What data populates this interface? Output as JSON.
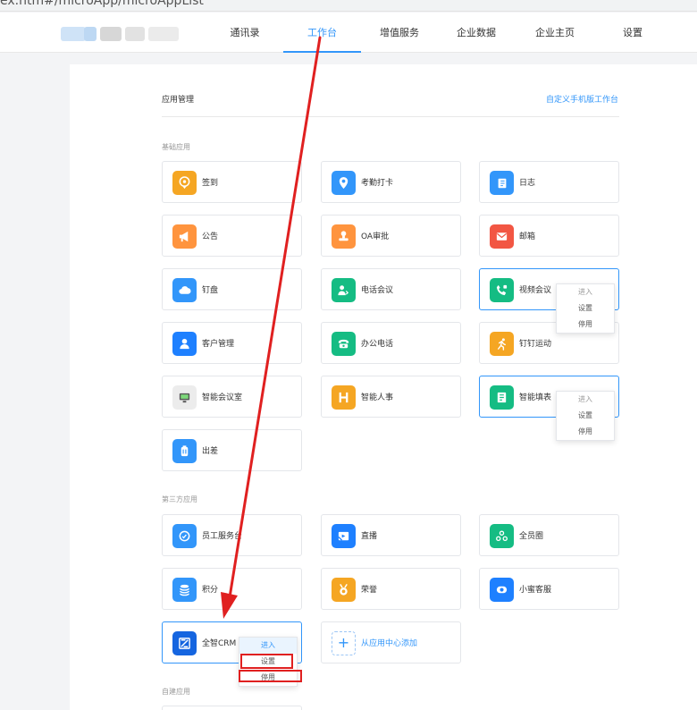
{
  "url": "ex.htm#/microApp/microAppList",
  "nav": {
    "items": [
      {
        "label": "通讯录",
        "active": false
      },
      {
        "label": "工作台",
        "active": true
      },
      {
        "label": "增值服务",
        "active": false
      },
      {
        "label": "企业数据",
        "active": false
      },
      {
        "label": "企业主页",
        "active": false
      },
      {
        "label": "设置",
        "active": false
      }
    ]
  },
  "main": {
    "title": "应用管理",
    "custom_link": "自定义手机版工作台",
    "sections": {
      "basic": "基础应用",
      "third": "第三方应用",
      "custom": "自建应用"
    },
    "apps": {
      "qiandao": {
        "name": "签到",
        "icon": "location-pin-icon",
        "color": "#f5a623"
      },
      "kaoqin": {
        "name": "考勤打卡",
        "icon": "location-pin-icon",
        "color": "#3296fa"
      },
      "rizhi": {
        "name": "日志",
        "icon": "notebook-icon",
        "color": "#3296fa"
      },
      "gonggao": {
        "name": "公告",
        "icon": "megaphone-icon",
        "color": "#ff943e"
      },
      "oa": {
        "name": "OA审批",
        "icon": "stamp-icon",
        "color": "#ff943e"
      },
      "youxiang": {
        "name": "邮箱",
        "icon": "mail-icon",
        "color": "#f25643"
      },
      "dingpan": {
        "name": "钉盘",
        "icon": "cloud-icon",
        "color": "#3296fa"
      },
      "dianhuahuiyi": {
        "name": "电话会议",
        "icon": "conference-call-icon",
        "color": "#15bc83"
      },
      "shipinhuiyi": {
        "name": "视频会议",
        "icon": "video-call-icon",
        "color": "#15bc83"
      },
      "kehu": {
        "name": "客户管理",
        "icon": "person-icon",
        "color": "#1e80ff"
      },
      "bangong": {
        "name": "办公电话",
        "icon": "telephone-icon",
        "color": "#15bc83"
      },
      "yundong": {
        "name": "钉钉运动",
        "icon": "running-icon",
        "color": "#f5a623"
      },
      "huiyishi": {
        "name": "智能会议室",
        "icon": "monitor-icon",
        "color": "#e8e8e8"
      },
      "renshi": {
        "name": "智能人事",
        "icon": "letter-h-icon",
        "color": "#f5a623"
      },
      "tianbiao": {
        "name": "智能填表",
        "icon": "form-icon",
        "color": "#15bc83"
      },
      "chuchai": {
        "name": "出差",
        "icon": "suitcase-icon",
        "color": "#3296fa"
      },
      "yuangong": {
        "name": "员工服务台",
        "icon": "chat-bot-icon",
        "color": "#3296fa"
      },
      "zhibo": {
        "name": "直播",
        "icon": "live-icon",
        "color": "#1e80ff"
      },
      "quanyuanquan": {
        "name": "全员圈",
        "icon": "circle-group-icon",
        "color": "#15bc83"
      },
      "jifen": {
        "name": "积分",
        "icon": "coins-icon",
        "color": "#3296fa"
      },
      "rongyu": {
        "name": "荣誉",
        "icon": "medal-icon",
        "color": "#f5a623"
      },
      "xiaomi": {
        "name": "小蜜客服",
        "icon": "headset-icon",
        "color": "#1e80ff"
      },
      "crm": {
        "name": "全智CRM",
        "icon": "crm-logo-icon",
        "color": "#1565e0"
      }
    },
    "add_app": "从应用中心添加"
  },
  "menus": {
    "shipinhuiyi": [
      "进入",
      "设置",
      "停用"
    ],
    "tianbiao": [
      "进入",
      "设置",
      "停用"
    ],
    "crm": [
      "进入",
      "设置",
      "停用"
    ]
  }
}
